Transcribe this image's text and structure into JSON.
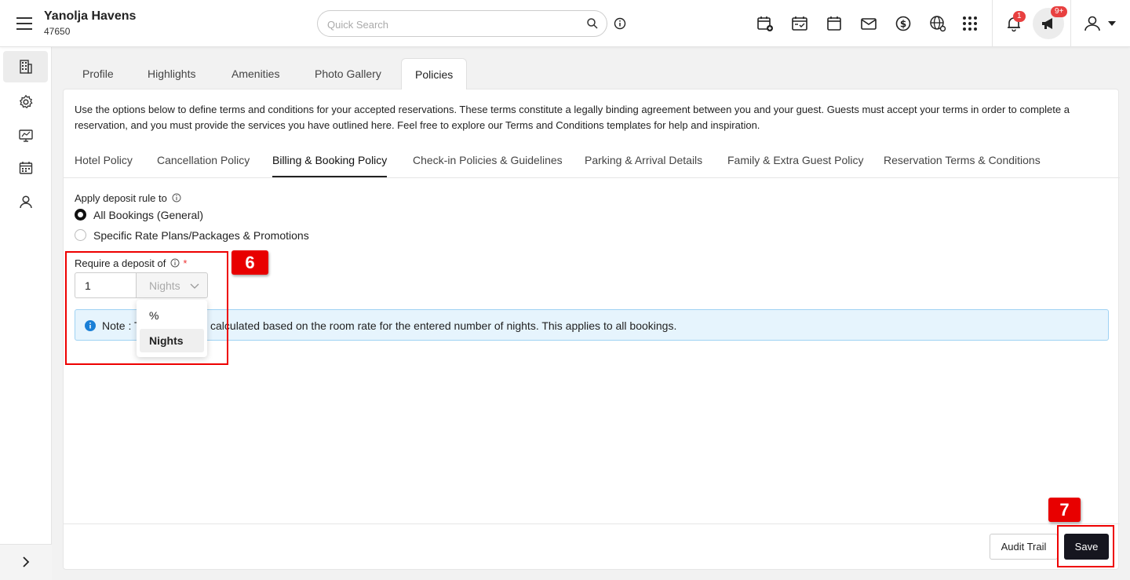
{
  "header": {
    "hotel_name": "Yanolja Havens",
    "hotel_id": "47650",
    "search_placeholder": "Quick Search",
    "notification_count": "1",
    "announcement_count": "9+"
  },
  "main_tabs": [
    {
      "label": "Profile"
    },
    {
      "label": "Highlights"
    },
    {
      "label": "Amenities"
    },
    {
      "label": "Photo Gallery"
    },
    {
      "label": "Policies",
      "active": true
    }
  ],
  "policies": {
    "description": "Use the options below to define terms and conditions for your accepted reservations. These terms constitute a legally binding agreement between you and your guest. Guests must accept your terms in order to complete a reservation, and you must provide the services you have outlined here. Feel free to explore our Terms and Conditions templates for help and inspiration.",
    "sub_tabs": [
      {
        "label": "Hotel Policy"
      },
      {
        "label": "Cancellation Policy"
      },
      {
        "label": "Billing & Booking Policy",
        "active": true
      },
      {
        "label": "Check-in Policies & Guidelines"
      },
      {
        "label": "Parking & Arrival Details"
      },
      {
        "label": "Family & Extra Guest Policy"
      },
      {
        "label": "Reservation Terms & Conditions"
      }
    ]
  },
  "deposit": {
    "apply_label": "Apply deposit rule to",
    "options": [
      {
        "label": "All Bookings (General)",
        "checked": true
      },
      {
        "label": "Specific Rate Plans/Packages & Promotions",
        "checked": false
      }
    ],
    "require_label": "Require a deposit of",
    "required_mark": "*",
    "amount_value": "1",
    "unit_selected": "Nights",
    "unit_options": [
      "%",
      "Nights"
    ],
    "note_prefix": "Note : T",
    "note_rest": "l be calculated based on the room rate for the entered number of nights. This applies to all bookings."
  },
  "footer": {
    "audit_label": "Audit Trail",
    "save_label": "Save"
  },
  "annotations": [
    "6",
    "7"
  ],
  "colors": {
    "save_bg": "#16161f",
    "note_bg": "#e6f4fd",
    "badge": "#e84040",
    "annotation": "#e80000"
  }
}
